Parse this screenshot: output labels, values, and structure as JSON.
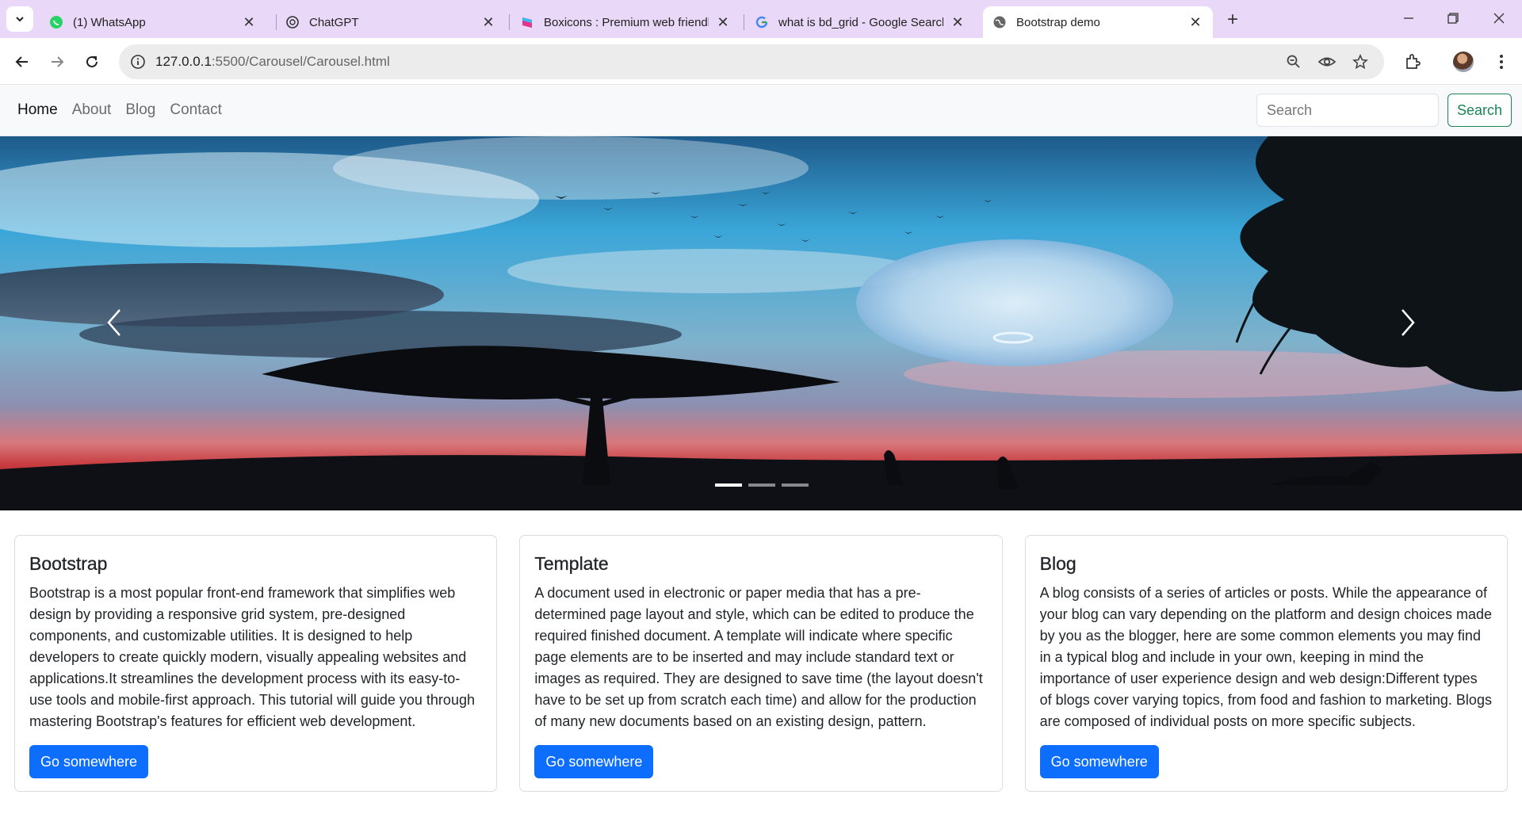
{
  "browser": {
    "tabs": [
      {
        "title": "(1) WhatsApp",
        "icon": "whatsapp-icon"
      },
      {
        "title": "ChatGPT",
        "icon": "chatgpt-icon"
      },
      {
        "title": "Boxicons : Premium web friendl",
        "icon": "boxicons-icon"
      },
      {
        "title": "what is bd_grid - Google Searcl",
        "icon": "google-icon"
      },
      {
        "title": "Bootstrap demo",
        "icon": "globe-icon",
        "active": true
      }
    ],
    "url_host": "127.0.0.1",
    "url_path": ":5500/Carousel/Carousel.html"
  },
  "navbar": {
    "links": [
      "Home",
      "About",
      "Blog",
      "Contact"
    ],
    "active": "Home",
    "search_placeholder": "Search",
    "search_button": "Search"
  },
  "carousel": {
    "slide_count": 3,
    "active_slide": 1
  },
  "cards": [
    {
      "title": "Bootstrap",
      "text": "Bootstrap is a most popular front-end framework that simplifies web design by providing a responsive grid system, pre-designed components, and customizable utilities. It is designed to help developers to create quickly modern, visually appealing websites and applications.It streamlines the development process with its easy-to-use tools and mobile-first approach. This tutorial will guide you through mastering Bootstrap's features for efficient web development.",
      "button": "Go somewhere"
    },
    {
      "title": "Template",
      "text": "A document used in electronic or paper media that has a pre-determined page layout and style, which can be edited to produce the required finished document. A template will indicate where specific page elements are to be inserted and may include standard text or images as required. They are designed to save time (the layout doesn't have to be set up from scratch each time) and allow for the production of many new documents based on an existing design, pattern.",
      "button": "Go somewhere"
    },
    {
      "title": "Blog",
      "text": "A blog consists of a series of articles or posts. While the appearance of your blog can vary depending on the platform and design choices made by you as the blogger, here are some common elements you may find in a typical blog and include in your own, keeping in mind the importance of user experience design and web design:Different types of blogs cover varying topics, from food and fashion to marketing. Blogs are composed of individual posts on more specific subjects.",
      "button": "Go somewhere"
    }
  ],
  "colors": {
    "tabstrip": "#e9d8f7",
    "primary": "#0d6efd",
    "success": "#198754"
  }
}
